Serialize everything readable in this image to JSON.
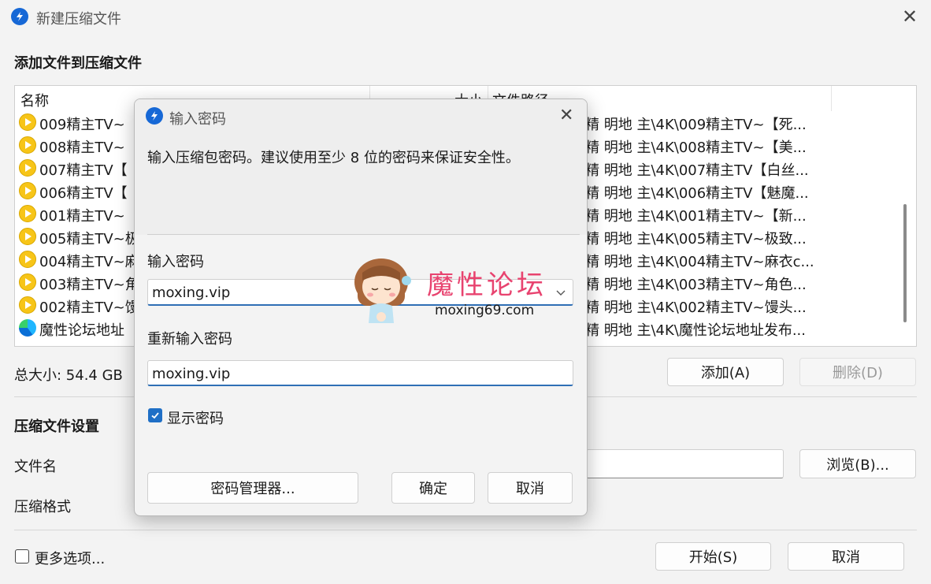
{
  "window": {
    "title": "新建压缩文件",
    "heading": "添加文件到压缩文件"
  },
  "file_list": {
    "columns": [
      "名称",
      "大小",
      "文件路径"
    ],
    "rows": [
      {
        "name": "009精主TV~",
        "path": "精 明地 主\\4K\\009精主TV~【死...",
        "icon": "video-icon"
      },
      {
        "name": "008精主TV~",
        "path": "精 明地 主\\4K\\008精主TV~【美...",
        "icon": "video-icon"
      },
      {
        "name": "007精主TV【",
        "path": "精 明地 主\\4K\\007精主TV【白丝...",
        "icon": "video-icon"
      },
      {
        "name": "006精主TV【",
        "path": "精 明地 主\\4K\\006精主TV【魅魔...",
        "icon": "video-icon"
      },
      {
        "name": "001精主TV~",
        "path": "精 明地 主\\4K\\001精主TV~【新...",
        "icon": "video-icon"
      },
      {
        "name": "005精主TV~极",
        "path": "精 明地 主\\4K\\005精主TV~极致...",
        "icon": "video-icon"
      },
      {
        "name": "004精主TV~麻",
        "path": "精 明地 主\\4K\\004精主TV~麻衣c...",
        "icon": "video-icon"
      },
      {
        "name": "003精主TV~角",
        "path": "精 明地 主\\4K\\003精主TV~角色...",
        "icon": "video-icon"
      },
      {
        "name": "002精主TV~馒",
        "path": "精 明地 主\\4K\\002精主TV~馒头...",
        "icon": "video-icon"
      },
      {
        "name": "魔性论坛地址",
        "path": "精 明地 主\\4K\\魔性论坛地址发布...",
        "icon": "edge-browser-icon"
      }
    ]
  },
  "summary": {
    "total_size": "总大小: 54.4 GB",
    "add_label": "添加(A)",
    "delete_label": "删除(D)"
  },
  "settings": {
    "heading": "压缩文件设置",
    "filename_label": "文件名",
    "format_label": "压缩格式",
    "browse_label": "浏览(B)...",
    "more_options_label": "更多选项...",
    "start_label": "开始(S)",
    "cancel_label": "取消"
  },
  "password_dialog": {
    "title": "输入密码",
    "instruction": "输入压缩包密码。建议使用至少 8 位的密码来保证安全性。",
    "password_label": "输入密码",
    "password_value": "moxing.vip",
    "confirm_label": "重新输入密码",
    "confirm_value": "moxing.vip",
    "show_password_label": "显示密码",
    "show_password_checked": true,
    "manager_label": "密码管理器...",
    "ok_label": "确定",
    "cancel_label": "取消"
  },
  "watermark": {
    "brand": "魔性论坛",
    "url": "moxing69.com"
  },
  "colors": {
    "accent": "#1f6fc6",
    "video_icon": "#f7c518",
    "watermark_pink": "#e8436f"
  }
}
